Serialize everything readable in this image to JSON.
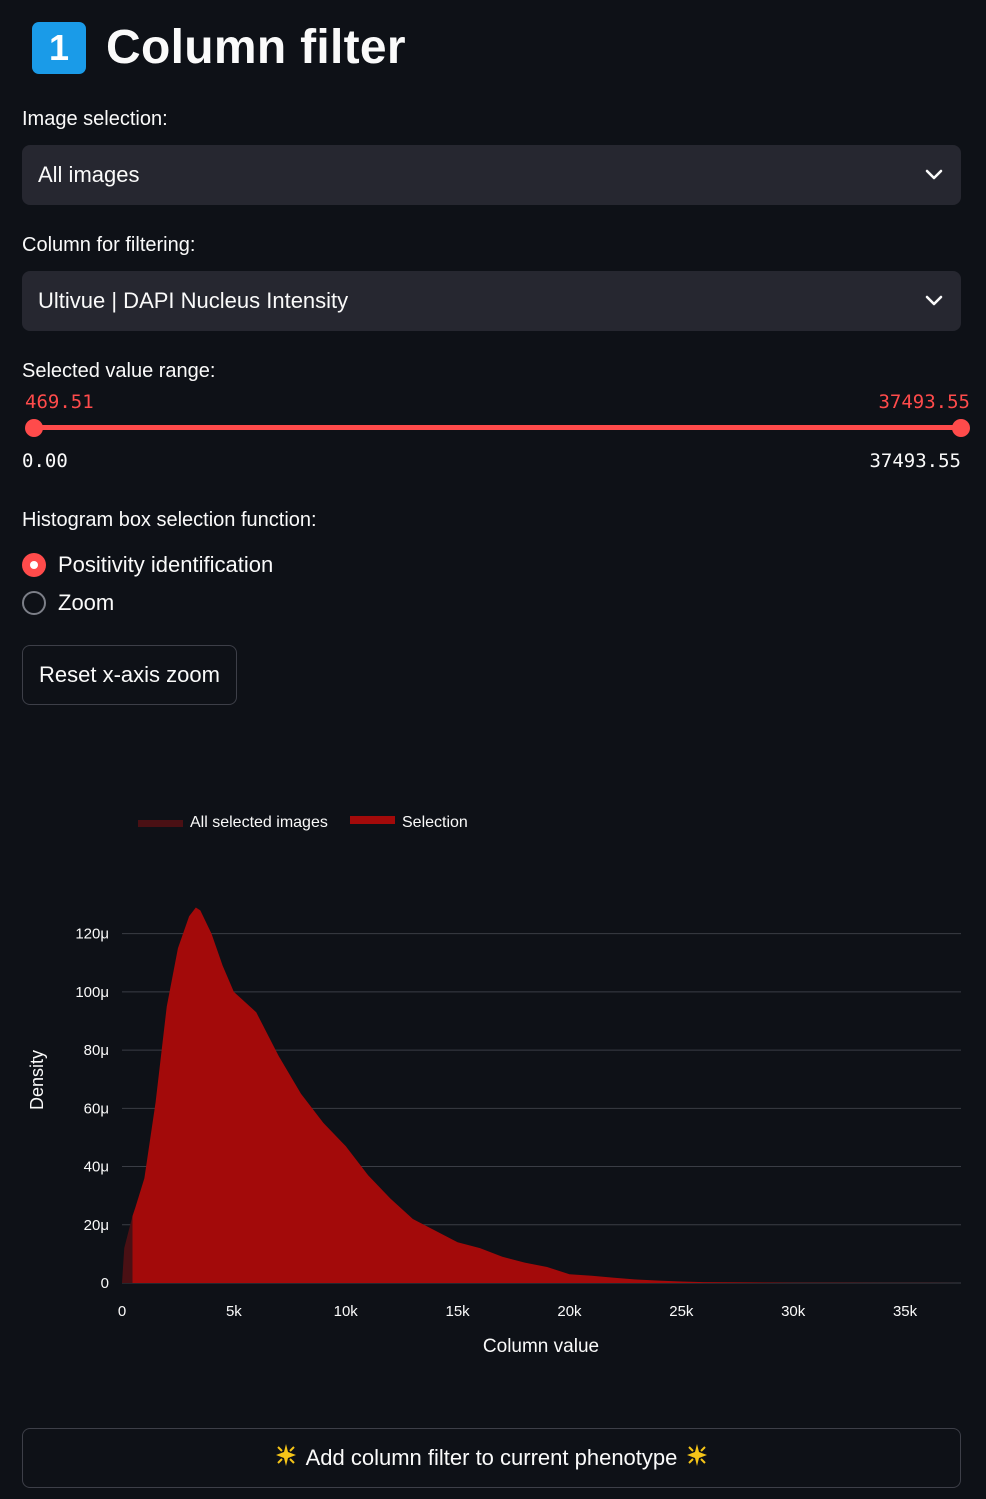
{
  "header": {
    "badge": "1",
    "title": "Column filter"
  },
  "image_selection": {
    "label": "Image selection:",
    "value": "All images"
  },
  "column_filter": {
    "label": "Column for filtering:",
    "value": "Ultivue | DAPI Nucleus Intensity"
  },
  "range": {
    "label": "Selected value range:",
    "low_value": "469.51",
    "high_value": "37493.55",
    "min": "0.00",
    "max": "37493.55",
    "low_num": 469.51,
    "high_num": 37493.55,
    "min_num": 0,
    "max_num": 37493.55
  },
  "histogram_mode": {
    "label": "Histogram box selection function:",
    "options": [
      "Positivity identification",
      "Zoom"
    ],
    "selected": "Positivity identification"
  },
  "reset_button": "Reset x-axis zoom",
  "add_button": "Add column filter to current phenotype",
  "colors": {
    "accent": "#ff4b4b",
    "selection_fill": "#a30a0a",
    "all_fill": "#4a1014",
    "background": "#0e1117"
  },
  "chart_data": {
    "type": "area",
    "xlabel": "Column value",
    "ylabel": "Density",
    "xlim": [
      0,
      37500
    ],
    "ylim": [
      0,
      0.000135
    ],
    "x_ticks": [
      0,
      5000,
      10000,
      15000,
      20000,
      25000,
      30000,
      35000
    ],
    "x_tick_labels": [
      "0",
      "5k",
      "10k",
      "15k",
      "20k",
      "25k",
      "30k",
      "35k"
    ],
    "y_ticks": [
      0,
      2e-05,
      4e-05,
      6e-05,
      8e-05,
      0.0001,
      0.00012
    ],
    "y_tick_labels": [
      "0",
      "20μ",
      "40μ",
      "60μ",
      "80μ",
      "100μ",
      "120μ"
    ],
    "grid": true,
    "legend_position": "top-left",
    "series": [
      {
        "name": "All selected images",
        "x": [
          0,
          100,
          200,
          300,
          400,
          469.51
        ],
        "y": [
          0,
          1.2e-05,
          1.5e-05,
          1.8e-05,
          2.1e-05,
          2.3e-05
        ]
      },
      {
        "name": "Selection",
        "x": [
          469.51,
          600,
          1000,
          1500,
          2000,
          2500,
          3000,
          3300,
          3500,
          4000,
          4500,
          5000,
          6000,
          7000,
          8000,
          9000,
          10000,
          11000,
          12000,
          13000,
          14000,
          15000,
          16000,
          17000,
          18000,
          19000,
          20000,
          21000,
          22000,
          23000,
          24000,
          25000,
          26000,
          28000,
          30000,
          32000,
          34000,
          36000,
          37493.55
        ],
        "y": [
          2.3e-05,
          2.6e-05,
          3.6e-05,
          6.2e-05,
          9.5e-05,
          0.000115,
          0.000126,
          0.000129,
          0.000128,
          0.00012,
          0.000109,
          0.0001,
          9.3e-05,
          7.8e-05,
          6.5e-05,
          5.5e-05,
          4.7e-05,
          3.7e-05,
          2.9e-05,
          2.2e-05,
          1.8e-05,
          1.4e-05,
          1.2e-05,
          9e-06,
          7e-06,
          5.5e-06,
          3e-06,
          2.5e-06,
          1.8e-06,
          1.2e-06,
          8e-07,
          5e-07,
          3e-07,
          2e-07,
          1e-07,
          8e-08,
          5e-08,
          3e-08,
          2e-08
        ]
      }
    ]
  }
}
